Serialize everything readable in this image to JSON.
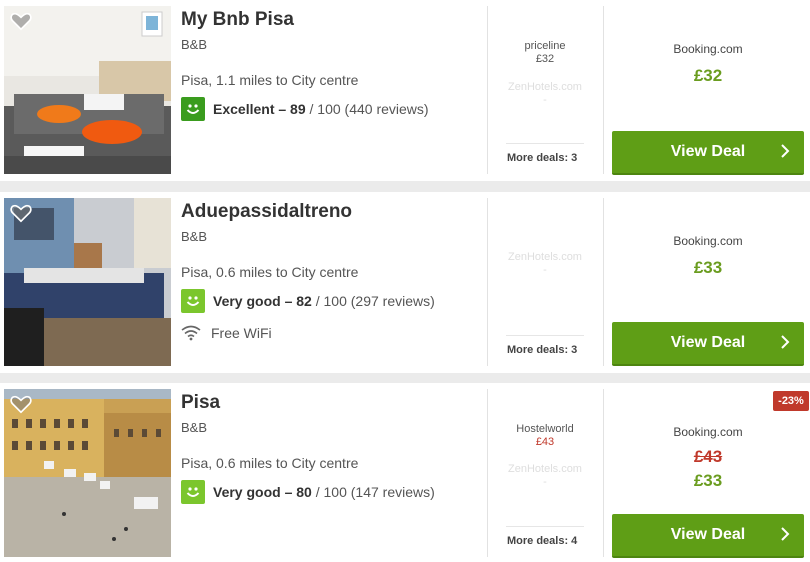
{
  "hotels": [
    {
      "name": "My Bnb Pisa",
      "type": "B&B",
      "location": "Pisa, 1.1 miles to City centre",
      "rating_label": "Excellent – 89",
      "rating_suffix": " / 100 (440 reviews)",
      "deals": [
        {
          "site": "priceline",
          "price": "£32"
        },
        {
          "site": "ZenHotels.com",
          "price": "-"
        }
      ],
      "more_deals": "More deals: 3",
      "main_site": "Booking.com",
      "main_price": "£32",
      "button": "View Deal"
    },
    {
      "name": "Aduepassidaltreno",
      "type": "B&B",
      "location": "Pisa, 0.6 miles to City centre",
      "rating_label": "Very good – 82",
      "rating_suffix": " / 100 (297 reviews)",
      "amenity": "Free WiFi",
      "deals": [
        {
          "site": "ZenHotels.com",
          "price": "-"
        }
      ],
      "more_deals": "More deals: 3",
      "main_site": "Booking.com",
      "main_price": "£33",
      "button": "View Deal"
    },
    {
      "name": "Pisa",
      "type": "B&B",
      "location": "Pisa, 0.6 miles to City centre",
      "rating_label": "Very good – 80",
      "rating_suffix": " / 100 (147 reviews)",
      "deals": [
        {
          "site": "Hostelworld",
          "price": "£43"
        },
        {
          "site": "ZenHotels.com",
          "price": "-"
        }
      ],
      "more_deals": "More deals: 4",
      "main_site": "Booking.com",
      "old_price": "£43",
      "main_price": "£33",
      "discount_badge": "-23%",
      "button": "View Deal"
    }
  ],
  "colors": {
    "accent_green": "#5f9e16",
    "price_green": "#6a9c1f",
    "discount_red": "#c0392b",
    "excellent_green": "#3a9c1e",
    "very_good_green": "#7bc62d"
  },
  "icons": [
    "heart-icon",
    "smiley-icon",
    "wifi-icon",
    "chevron-right-icon"
  ]
}
